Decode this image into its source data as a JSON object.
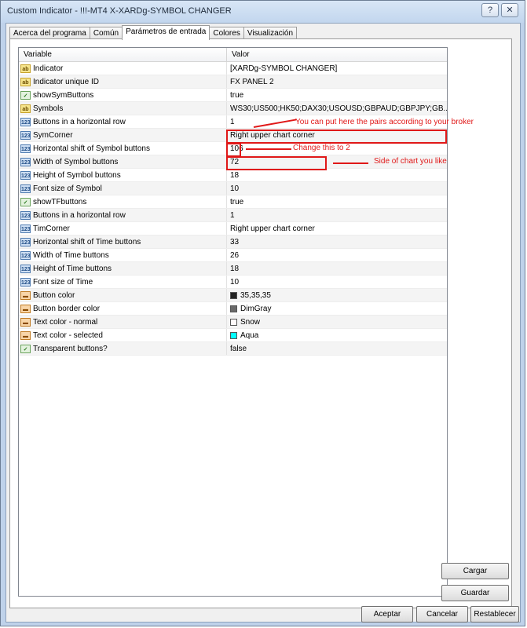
{
  "window": {
    "title": "Custom Indicator - !!!-MT4 X-XARDg-SYMBOL CHANGER",
    "help_glyph": "?",
    "close_glyph": "✕"
  },
  "tabs": [
    {
      "label": "Acerca del programa",
      "active": false
    },
    {
      "label": "Común",
      "active": false
    },
    {
      "label": "Parámetros de entrada",
      "active": true
    },
    {
      "label": "Colores",
      "active": false
    },
    {
      "label": "Visualización",
      "active": false
    }
  ],
  "grid": {
    "col_variable": "Variable",
    "col_value": "Valor",
    "rows": [
      {
        "type": "str",
        "icon": "ab",
        "variable": "Indicator",
        "value": "[XARDg-SYMBOL CHANGER]"
      },
      {
        "type": "str",
        "icon": "ab",
        "variable": "Indicator unique ID",
        "value": "FX PANEL 2"
      },
      {
        "type": "bool",
        "icon": "✓",
        "variable": "showSymButtons",
        "value": "true"
      },
      {
        "type": "str",
        "icon": "ab",
        "variable": "Symbols",
        "value": "WS30;US500;HK50;DAX30;USOUSD;GBPAUD;GBPJPY;GB..."
      },
      {
        "type": "int",
        "icon": "123",
        "variable": "Buttons in a horizontal row",
        "value": "1"
      },
      {
        "type": "int",
        "icon": "123",
        "variable": "SymCorner",
        "value": "Right upper chart corner"
      },
      {
        "type": "int",
        "icon": "123",
        "variable": "Horizontal shift of Symbol buttons",
        "value": "106"
      },
      {
        "type": "int",
        "icon": "123",
        "variable": "Width of Symbol buttons",
        "value": "72"
      },
      {
        "type": "int",
        "icon": "123",
        "variable": "Height of Symbol buttons",
        "value": "18"
      },
      {
        "type": "int",
        "icon": "123",
        "variable": "Font size of Symbol",
        "value": "10"
      },
      {
        "type": "bool",
        "icon": "✓",
        "variable": "showTFbuttons",
        "value": "true"
      },
      {
        "type": "int",
        "icon": "123",
        "variable": "Buttons in a horizontal row",
        "value": "1"
      },
      {
        "type": "int",
        "icon": "123",
        "variable": "TimCorner",
        "value": "Right upper chart corner"
      },
      {
        "type": "int",
        "icon": "123",
        "variable": "Horizontal shift of Time buttons",
        "value": "33"
      },
      {
        "type": "int",
        "icon": "123",
        "variable": "Width of Time buttons",
        "value": "26"
      },
      {
        "type": "int",
        "icon": "123",
        "variable": "Height of Time buttons",
        "value": "18"
      },
      {
        "type": "int",
        "icon": "123",
        "variable": "Font size of Time",
        "value": "10"
      },
      {
        "type": "color",
        "icon": "▬",
        "variable": "Button color",
        "value": "35,35,35",
        "swatch": "#232323"
      },
      {
        "type": "color",
        "icon": "▬",
        "variable": "Button border color",
        "value": "DimGray",
        "swatch": "#696969"
      },
      {
        "type": "color",
        "icon": "▬",
        "variable": "Text color - normal",
        "value": "Snow",
        "swatch": "#fffafa"
      },
      {
        "type": "color",
        "icon": "▬",
        "variable": "Text color - selected",
        "value": "Aqua",
        "swatch": "#00ffff"
      },
      {
        "type": "bool",
        "icon": "✓",
        "variable": "Transparent buttons?",
        "value": "false"
      }
    ]
  },
  "annotations": {
    "symbols_note": "You can put here the pairs according to your broker",
    "row_note": "Change this to 2",
    "corner_note": "Side of chart you like",
    "color": "#e01818"
  },
  "side_buttons": {
    "load": "Cargar",
    "save": "Guardar"
  },
  "footer_buttons": {
    "ok": "Aceptar",
    "cancel": "Cancelar",
    "reset": "Restablecer"
  }
}
